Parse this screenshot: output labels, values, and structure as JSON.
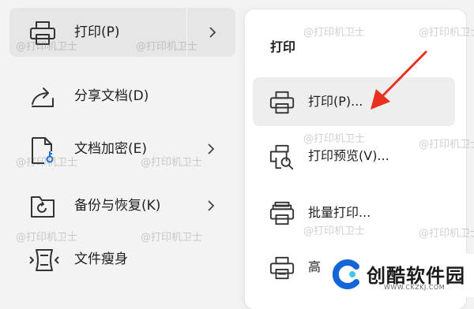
{
  "left_menu": {
    "items": [
      {
        "label": "打印(P)",
        "has_submenu": true,
        "active": true,
        "icon": "printer-icon"
      },
      {
        "label": "分享文档(D)",
        "has_submenu": false,
        "icon": "share-icon"
      },
      {
        "label": "文档加密(E)",
        "has_submenu": true,
        "icon": "document-lock-icon"
      },
      {
        "label": "备份与恢复(K)",
        "has_submenu": true,
        "icon": "backup-restore-icon"
      },
      {
        "label": "文件瘦身",
        "has_submenu": false,
        "icon": "file-slim-icon"
      }
    ]
  },
  "submenu": {
    "title": "打印",
    "items": [
      {
        "label": "打印(P)...",
        "active": true,
        "icon": "printer-icon"
      },
      {
        "label": "打印预览(V)...",
        "icon": "print-preview-icon"
      },
      {
        "label": "批量打印...",
        "icon": "batch-print-icon"
      },
      {
        "label": "高",
        "icon": "advanced-print-icon"
      }
    ]
  },
  "annotation": {
    "color": "#e8321f",
    "icon": "red-arrow-icon"
  },
  "watermark": "@打印机卫士",
  "branding": {
    "name": "创酷软件园",
    "url": "WWW.CKZKJ.COM",
    "logo_color": "#1565d8",
    "accent_color": "#3ec6f0"
  }
}
